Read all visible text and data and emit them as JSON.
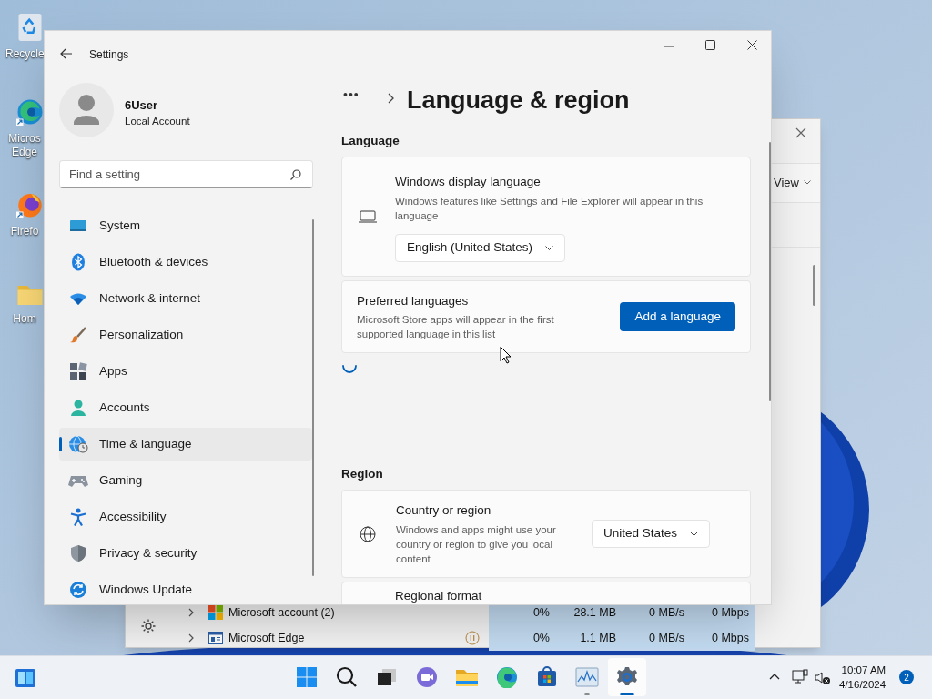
{
  "desktop_icons": [
    {
      "label": "Recycle"
    },
    {
      "label": "Micros Edge"
    },
    {
      "label": "Firefo"
    },
    {
      "label": "Hom"
    }
  ],
  "task_manager": {
    "menu": "View",
    "rows": [
      {
        "name": "Microsoft account (2)",
        "paused": false,
        "cpu": "0%",
        "memory": "28.1 MB",
        "disk": "0 MB/s",
        "network": "0 Mbps"
      },
      {
        "name": "Microsoft Edge",
        "paused": true,
        "cpu": "0%",
        "memory": "1.1 MB",
        "disk": "0 MB/s",
        "network": "0 Mbps"
      }
    ]
  },
  "settings": {
    "title": "Settings",
    "user": {
      "name": "6User",
      "account_type": "Local Account"
    },
    "search": {
      "placeholder": "Find a setting"
    },
    "nav": [
      {
        "label": "System",
        "selected": false
      },
      {
        "label": "Bluetooth & devices",
        "selected": false
      },
      {
        "label": "Network & internet",
        "selected": false
      },
      {
        "label": "Personalization",
        "selected": false
      },
      {
        "label": "Apps",
        "selected": false
      },
      {
        "label": "Accounts",
        "selected": false
      },
      {
        "label": "Time & language",
        "selected": true
      },
      {
        "label": "Gaming",
        "selected": false
      },
      {
        "label": "Accessibility",
        "selected": false
      },
      {
        "label": "Privacy & security",
        "selected": false
      },
      {
        "label": "Windows Update",
        "selected": false
      }
    ],
    "breadcrumb": "•••",
    "page_title": "Language & region",
    "sections": [
      {
        "heading": "Language",
        "loading": true,
        "cards": [
          {
            "kind": "dropdown-below",
            "title": "Windows display language",
            "description": "Windows features like Settings and File Explorer will appear in this language",
            "value": "English (United States)"
          },
          {
            "kind": "button",
            "title": "Preferred languages",
            "description": "Microsoft Store apps will appear in the first supported language in this list",
            "button": "Add a language"
          }
        ]
      },
      {
        "heading": "Region",
        "cards": [
          {
            "kind": "dropdown-right",
            "title": "Country or region",
            "description": "Windows and apps might use your country or region to give you local content",
            "value": "United States"
          },
          {
            "kind": "title-only",
            "title": "Regional format"
          }
        ]
      }
    ]
  },
  "taskbar": {
    "apps": [
      {
        "active": false,
        "running": false
      },
      {
        "active": false,
        "running": false
      },
      {
        "active": false,
        "running": false
      },
      {
        "active": false,
        "running": false
      },
      {
        "active": false,
        "running": false
      },
      {
        "active": false,
        "running": false
      },
      {
        "active": false,
        "running": false
      },
      {
        "active": false,
        "running": true
      },
      {
        "active": true,
        "running": true
      }
    ],
    "time": "10:07 AM",
    "date": "4/16/2024",
    "notifications": "2"
  }
}
